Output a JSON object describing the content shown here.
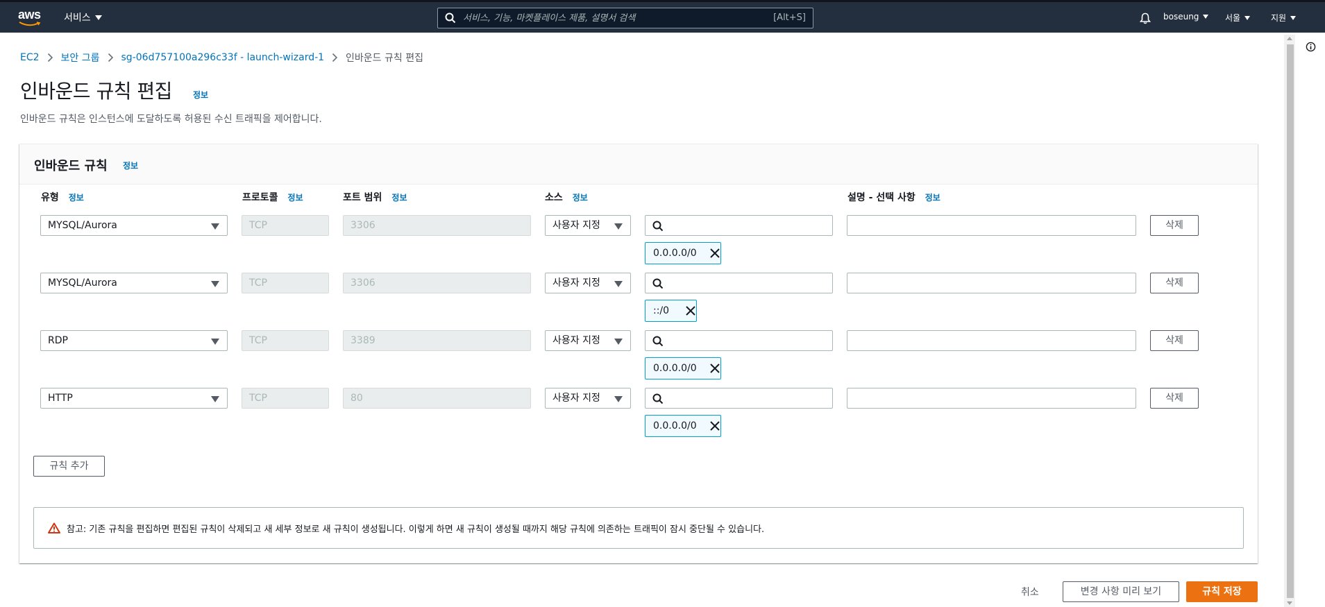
{
  "nav": {
    "logo_text": "aws",
    "services_label": "서비스",
    "search_placeholder": "서비스, 기능, 마켓플레이스 제품, 설명서 검색",
    "search_shortcut": "[Alt+S]",
    "user": "boseung",
    "region": "서울",
    "support": "지원"
  },
  "breadcrumb": {
    "items": [
      "EC2",
      "보안 그룹",
      "sg-06d757100a296c33f - launch-wizard-1"
    ],
    "current": "인바운드 규칙 편집"
  },
  "page": {
    "title": "인바운드 규칙 편집",
    "info": "정보",
    "description": "인바운드 규칙은 인스턴스에 도달하도록 허용된 수신 트래픽을 제어합니다."
  },
  "panel": {
    "title": "인바운드 규칙",
    "info": "정보",
    "columns": {
      "type": "유형",
      "protocol": "프로토콜",
      "port_range": "포트 범위",
      "source": "소스",
      "description": "설명 - 선택 사항"
    },
    "delete_label": "삭제",
    "add_rule_label": "규칙 추가",
    "rules": [
      {
        "type": "MYSQL/Aurora",
        "protocol": "TCP",
        "port": "3306",
        "source_mode": "사용자 지정",
        "search_value": "",
        "cidr": "0.0.0.0/0",
        "description": ""
      },
      {
        "type": "MYSQL/Aurora",
        "protocol": "TCP",
        "port": "3306",
        "source_mode": "사용자 지정",
        "search_value": "",
        "cidr": "::/0",
        "description": ""
      },
      {
        "type": "RDP",
        "protocol": "TCP",
        "port": "3389",
        "source_mode": "사용자 지정",
        "search_value": "",
        "cidr": "0.0.0.0/0",
        "description": ""
      },
      {
        "type": "HTTP",
        "protocol": "TCP",
        "port": "80",
        "source_mode": "사용자 지정",
        "search_value": "",
        "cidr": "0.0.0.0/0",
        "description": ""
      }
    ],
    "alert_message": "참고: 기존 규칙을 편집하면 편집된 규칙이 삭제되고 새 세부 정보로 새 규칙이 생성됩니다. 이렇게 하면 새 규칙이 생성될 때까지 해당 규칙에 의존하는 트래픽이 잠시 중단될 수 있습니다."
  },
  "footer": {
    "cancel_label": "취소",
    "preview_label": "변경 사항 미리 보기",
    "save_label": "규칙 저장"
  },
  "colors": {
    "nav_bg": "#232f3e",
    "link": "#0073bb",
    "primary_button": "#ec7211",
    "token_border": "#00a1c9",
    "warning": "#d13212"
  }
}
